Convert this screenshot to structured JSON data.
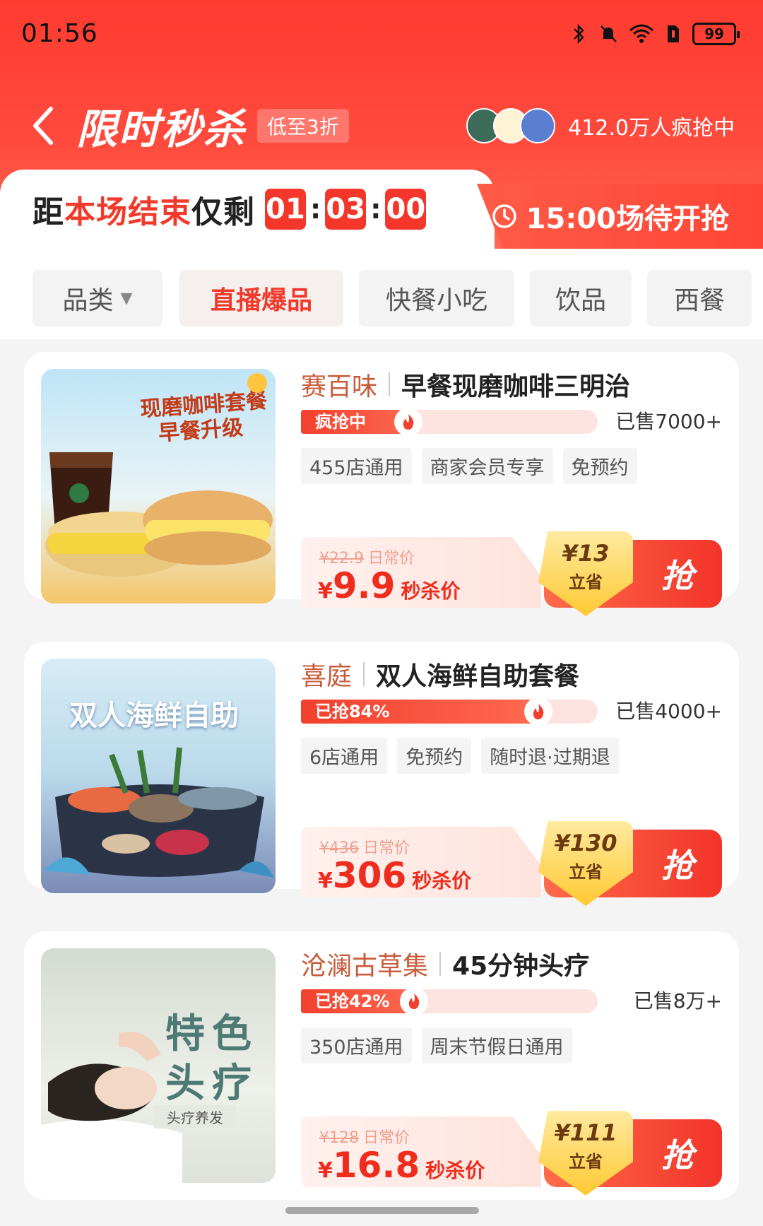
{
  "status_bar": {
    "time": "01:56",
    "battery": "99"
  },
  "header": {
    "title": "限时秒杀",
    "discount_tag": "低至3折",
    "grab_count": "412.0万人疯抢中"
  },
  "countdown": {
    "label_prefix": "距",
    "label_highlight": "本场结束",
    "label_suffix": "仅剩",
    "hours": "01",
    "minutes": "03",
    "seconds": "00",
    "next_session": "15:00场待开抢"
  },
  "tabs": [
    {
      "label": "品类"
    },
    {
      "label": "直播爆品"
    },
    {
      "label": "快餐小吃"
    },
    {
      "label": "饮品"
    },
    {
      "label": "西餐"
    }
  ],
  "products": [
    {
      "shop": "赛百味",
      "deal": "早餐现磨咖啡三明治",
      "progress_text": "疯抢中",
      "progress_fraction": 0.4,
      "sold": "已售7000+",
      "tags": [
        "455店通用",
        "商家会员专享",
        "免预约"
      ],
      "orig_price": "¥22.9",
      "orig_label": "日常价",
      "currency": "¥",
      "flash_price": "9.9",
      "flash_label": "秒杀价",
      "save_amount": "¥13",
      "save_word": "立省",
      "button": "抢",
      "image_text_1": "现磨咖啡套餐",
      "image_text_2": "早餐升级"
    },
    {
      "shop": "喜庭",
      "deal": "双人海鲜自助套餐",
      "progress_text": "已抢84%",
      "progress_fraction": 0.84,
      "sold": "已售4000+",
      "tags": [
        "6店通用",
        "免预约",
        "随时退·过期退"
      ],
      "orig_price": "¥436",
      "orig_label": "日常价",
      "currency": "¥",
      "flash_price": "306",
      "flash_label": "秒杀价",
      "save_amount": "¥130",
      "save_word": "立省",
      "button": "抢",
      "image_text_1": "双人海鲜自助"
    },
    {
      "shop": "沧澜古草集",
      "deal": "45分钟头疗",
      "progress_text": "已抢42%",
      "progress_fraction": 0.42,
      "sold": "已售8万+",
      "tags": [
        "350店通用",
        "周末节假日通用"
      ],
      "orig_price": "¥128",
      "orig_label": "日常价",
      "currency": "¥",
      "flash_price": "16.8",
      "flash_label": "秒杀价",
      "save_amount": "¥111",
      "save_word": "立省",
      "button": "抢",
      "image_text_1": "特色",
      "image_text_2": "头疗",
      "image_text_3": "头疗养发"
    }
  ]
}
